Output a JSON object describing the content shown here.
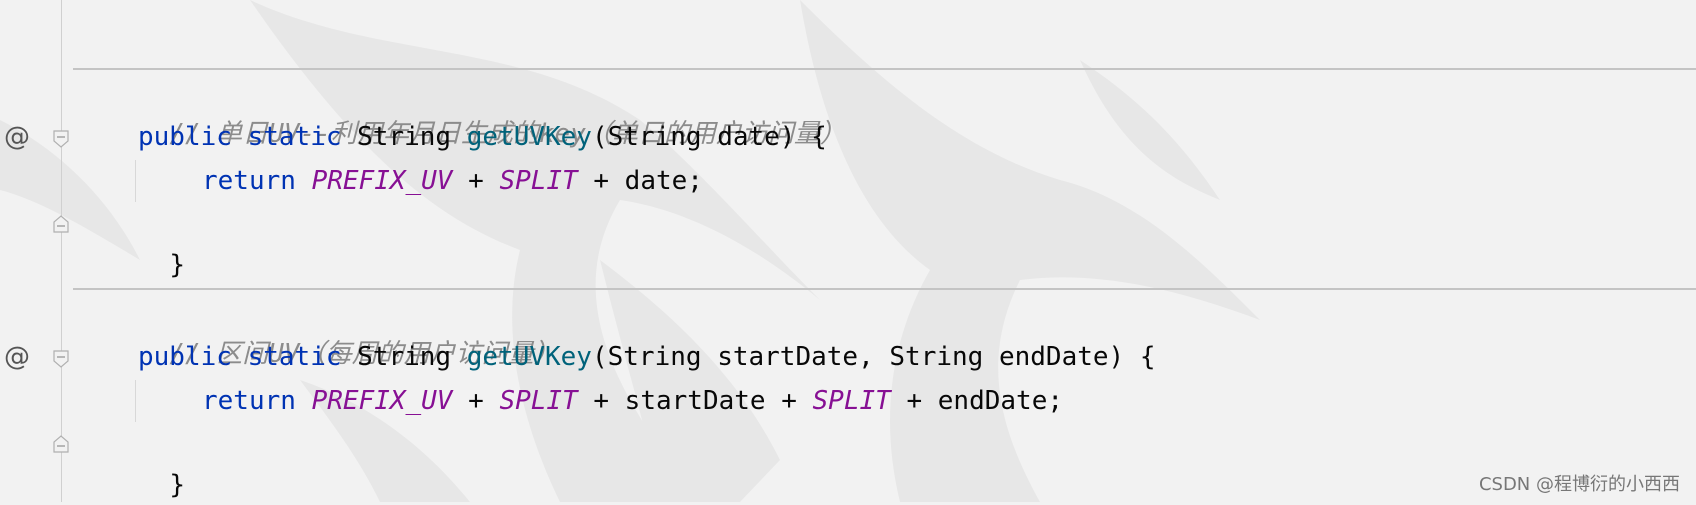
{
  "editor": {
    "block1": {
      "comment": "// 单日UV--利用年月日生成的key（单日的用户访问量）",
      "decl": {
        "kw_public": "public",
        "kw_static": "static",
        "type": "String",
        "method": "getUVKey",
        "params": "(String date) {"
      },
      "ret": {
        "kw_return": "return",
        "c1": "PREFIX_UV",
        "op1": " + ",
        "c2": "SPLIT",
        "rest": " + date;"
      },
      "close": "}"
    },
    "block2": {
      "comment": "// 区间UV（每周的用户访问量）",
      "decl": {
        "kw_public": "public",
        "kw_static": "static",
        "type": "String",
        "method": "getUVKey",
        "params": "(String startDate, String endDate) {"
      },
      "ret": {
        "kw_return": "return",
        "c1": "PREFIX_UV",
        "op1": " + ",
        "c2": "SPLIT",
        "op2": " + startDate + ",
        "c3": "SPLIT",
        "rest": " + endDate;"
      },
      "close": "}"
    },
    "gutter": {
      "annotation_marker": "@"
    }
  },
  "credit": "CSDN @程博衍的小西西",
  "colors": {
    "keyword": "#0033b3",
    "method": "#00627a",
    "constant": "#871094",
    "comment": "#8c8c8c",
    "text": "#080808",
    "background": "#f2f2f2"
  }
}
